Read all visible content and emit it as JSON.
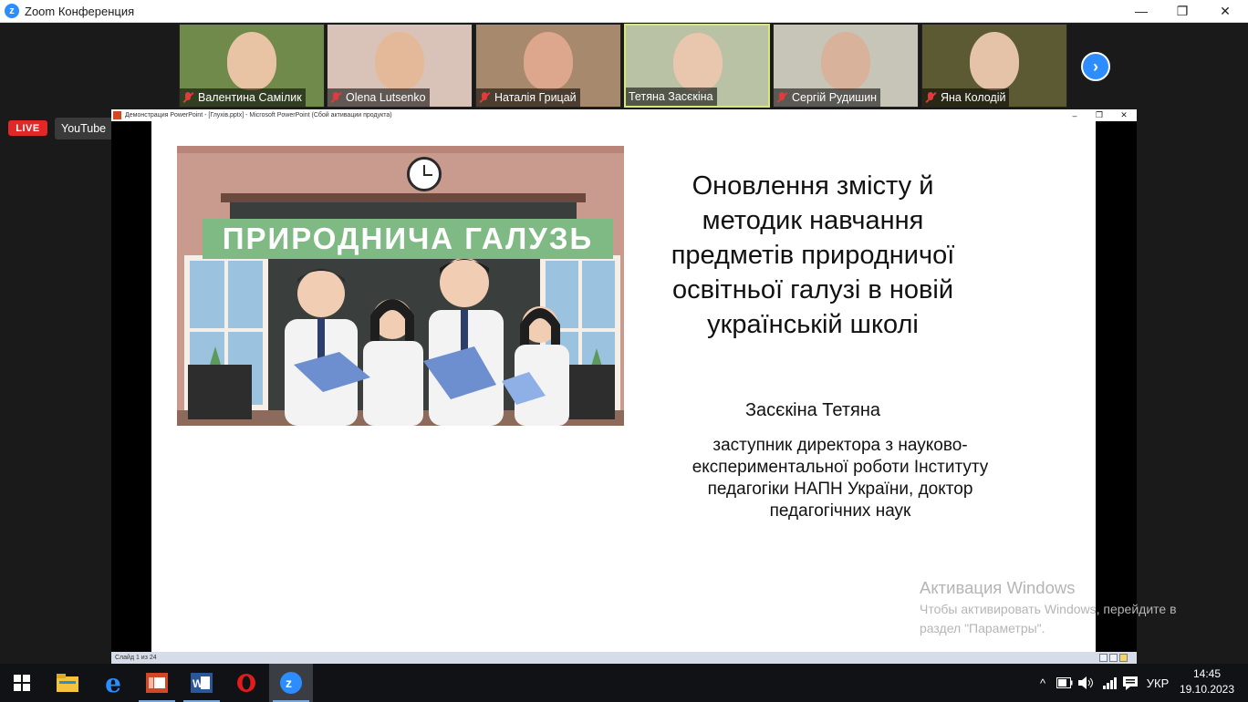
{
  "window": {
    "app_title": "Zoom Конференция",
    "minimize": "—",
    "restore": "❐",
    "close": "✕"
  },
  "participants": [
    {
      "name": "Валентина Самілик",
      "muted": true,
      "bg": "#6f8a4a",
      "skin": "#e8c4a5"
    },
    {
      "name": "Olena Lutsenko",
      "muted": true,
      "bg": "#d9c3b8",
      "skin": "#e3b999"
    },
    {
      "name": "Наталія Грицай",
      "muted": true,
      "bg": "#a78a6d",
      "skin": "#dca78c"
    },
    {
      "name": "Тетяна Засєкіна",
      "muted": false,
      "bg": "#b9c2a5",
      "skin": "#e9c7ae"
    },
    {
      "name": "Сергій Рудишин",
      "muted": true,
      "bg": "#c7c5b8",
      "skin": "#d8b29a"
    },
    {
      "name": "Яна Колодій",
      "muted": true,
      "bg": "#5c5a33",
      "skin": "#e5c3a8"
    }
  ],
  "strip": {
    "next_icon": "›"
  },
  "live": {
    "badge": "LIVE",
    "service": "YouTube",
    "caret": "▼"
  },
  "powerpoint": {
    "window_title": "Демонстрация PowerPoint - [Глухів.pptx] - Microsoft PowerPoint (Сбой активации продукта)",
    "status": "Слайд 1 из 24",
    "controls": {
      "min": "–",
      "max": "❐",
      "close": "✕"
    }
  },
  "slide": {
    "banner": "ПРИРОДНИЧА ГАЛУЗЬ",
    "title_lines": [
      "Оновлення змісту й",
      "методик навчання",
      "предметів  природничої",
      "освітньої галузі в новій",
      "українській школі"
    ],
    "author": "Засєкіна Тетяна",
    "role_lines": [
      "заступник директора з науково-",
      "експериментальної роботи Інституту",
      "педагогіки НАПН України, доктор",
      "педагогічних наук"
    ]
  },
  "activation": {
    "heading": "Активация Windows",
    "text": "Чтобы активировать Windows, перейдите в раздел \"Параметры\"."
  },
  "taskbar": {
    "apps": [
      "windows-start",
      "file-explorer",
      "edge",
      "powerpoint",
      "word",
      "opera",
      "zoom"
    ],
    "tray_caret": "^",
    "language": "УКР",
    "time": "14:45",
    "date": "19.10.2023"
  },
  "colors": {
    "zoom_blue": "#2d8cff",
    "live_red": "#e02828",
    "banner_green": "#7fba84",
    "active_speaker": "#d7e77a"
  }
}
